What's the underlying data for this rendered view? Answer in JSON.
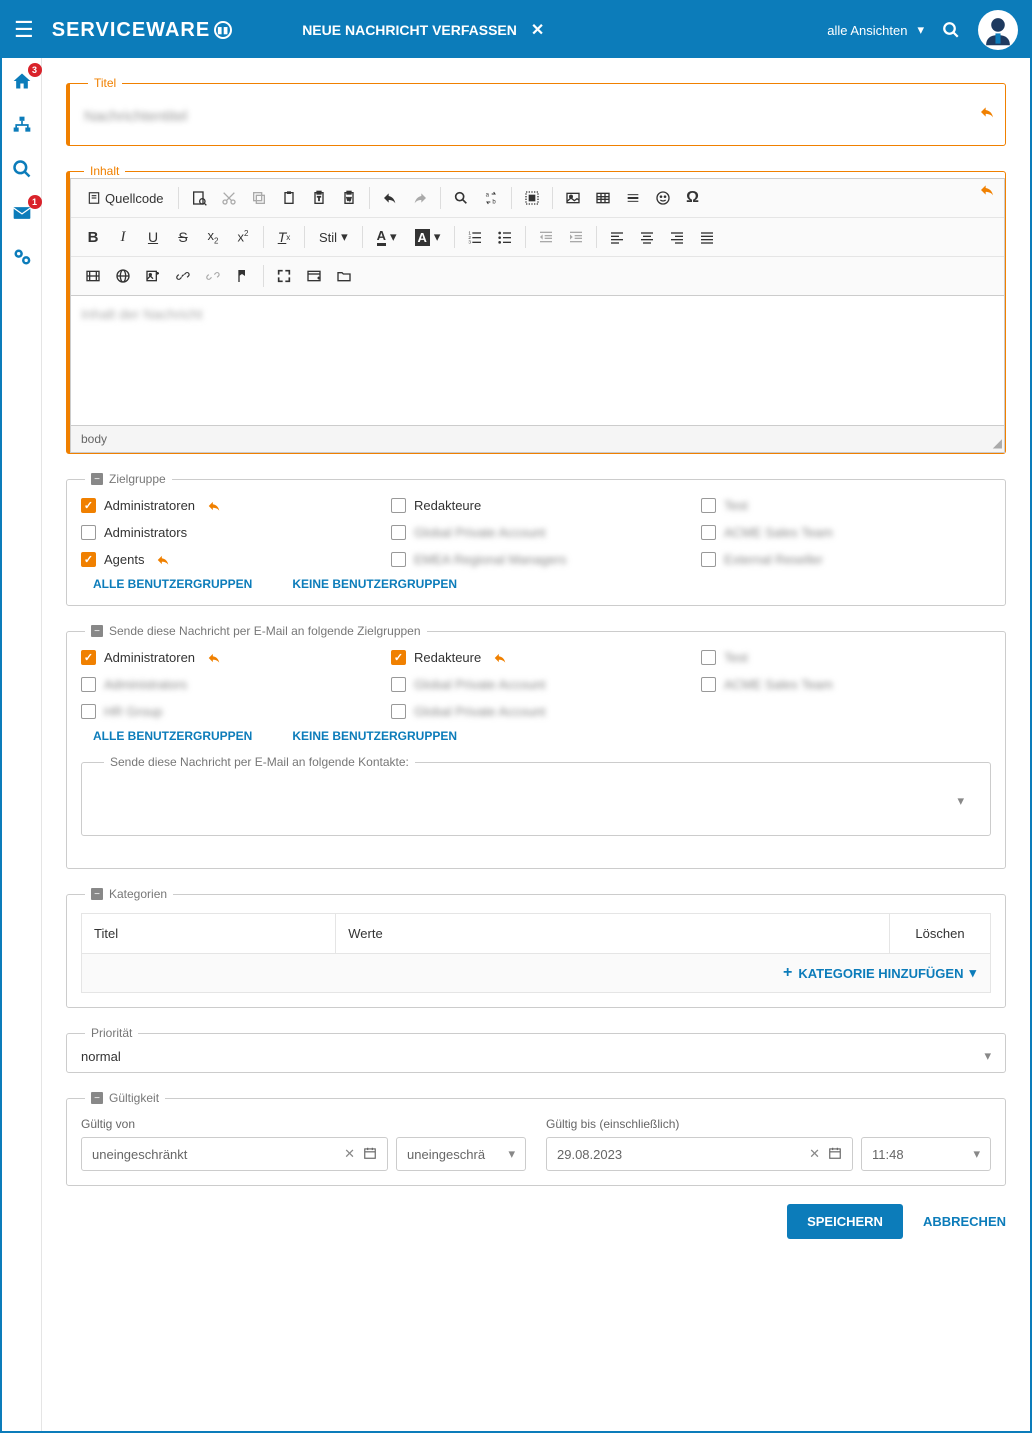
{
  "header": {
    "logo": "SERVICEWARE",
    "modal_title": "NEUE NACHRICHT VERFASSEN",
    "views_label": "alle Ansichten"
  },
  "sidebar": {
    "home_badge": "3",
    "mail_badge": "1"
  },
  "form": {
    "title_legend": "Titel",
    "title_value": "Nachrichtentitel",
    "content_legend": "Inhalt",
    "quellcode": "Quellcode",
    "style_label": "Stil",
    "editor_placeholder": "Inhalt der Nachricht",
    "editor_status": "body"
  },
  "zielgruppe": {
    "legend": "Zielgruppe",
    "items": [
      {
        "label": "Administratoren",
        "checked": true,
        "reply": true,
        "blur": false
      },
      {
        "label": "Redakteure",
        "checked": false,
        "reply": false,
        "blur": false
      },
      {
        "label": "Test",
        "checked": false,
        "reply": false,
        "blur": true
      },
      {
        "label": "Administrators",
        "checked": false,
        "reply": false,
        "blur": false
      },
      {
        "label": "Global Private Account",
        "checked": false,
        "reply": false,
        "blur": true
      },
      {
        "label": "ACME Sales Team",
        "checked": false,
        "reply": false,
        "blur": true
      },
      {
        "label": "Agents",
        "checked": true,
        "reply": true,
        "blur": false
      },
      {
        "label": "EMEA Regional Managers",
        "checked": false,
        "reply": false,
        "blur": true
      },
      {
        "label": "External Reseller",
        "checked": false,
        "reply": false,
        "blur": true
      }
    ],
    "all_link": "ALLE BENUTZERGRUPPEN",
    "none_link": "KEINE BENUTZERGRUPPEN"
  },
  "email_targets": {
    "legend": "Sende diese Nachricht per E-Mail an folgende Zielgruppen",
    "items": [
      {
        "label": "Administratoren",
        "checked": true,
        "reply": true,
        "blur": false
      },
      {
        "label": "Redakteure",
        "checked": true,
        "reply": true,
        "blur": false
      },
      {
        "label": "Test",
        "checked": false,
        "reply": false,
        "blur": true
      },
      {
        "label": "Administrators",
        "checked": false,
        "reply": false,
        "blur": true
      },
      {
        "label": "Global Private Account",
        "checked": false,
        "reply": false,
        "blur": true
      },
      {
        "label": "ACME Sales Team",
        "checked": false,
        "reply": false,
        "blur": true
      },
      {
        "label": "HR Group",
        "checked": false,
        "reply": false,
        "blur": true
      },
      {
        "label": "Global Private Account",
        "checked": false,
        "reply": false,
        "blur": true
      }
    ],
    "all_link": "ALLE BENUTZERGRUPPEN",
    "none_link": "KEINE BENUTZERGRUPPEN",
    "contacts_legend": "Sende diese Nachricht per E-Mail an folgende Kontakte:"
  },
  "categories": {
    "legend": "Kategorien",
    "col_title": "Titel",
    "col_values": "Werte",
    "col_delete": "Löschen",
    "add_label": "KATEGORIE HINZUFÜGEN"
  },
  "priority": {
    "legend": "Priorität",
    "value": "normal"
  },
  "validity": {
    "legend": "Gültigkeit",
    "from_label": "Gültig von",
    "to_label": "Gültig bis (einschließlich)",
    "from_date": "uneingeschränkt",
    "from_time": "uneingeschrä",
    "to_date": "29.08.2023",
    "to_time": "11:48"
  },
  "actions": {
    "save": "SPEICHERN",
    "cancel": "ABBRECHEN"
  }
}
